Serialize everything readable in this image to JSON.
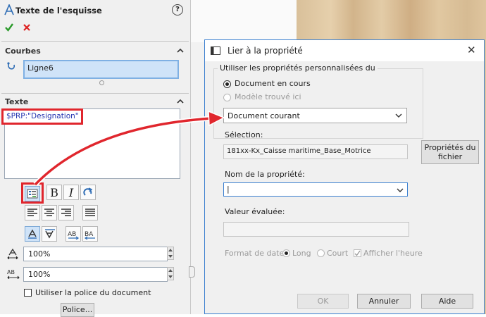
{
  "panel": {
    "title": "Texte de l'esquisse",
    "help_glyph": "?",
    "curves_section": "Courbes",
    "curve_value": "Ligne6",
    "text_section": "Texte",
    "text_value": "$PRP:\"Designation\"",
    "format_bold": "B",
    "format_italic": "I",
    "width_value": "100%",
    "spacing_value": "100%",
    "use_document_font": "Utiliser la police du document",
    "font_button": "Police...",
    "accent_color": "#2f6db5",
    "highlight_color": "#e0262d"
  },
  "dialog": {
    "title": "Lier à la propriété",
    "group_label": "Utiliser les propriétés personnalisées du",
    "radio_document": "Document en cours",
    "radio_model": "Modèle trouvé ici",
    "source_combo": "Document courant",
    "selection_label": "Sélection:",
    "selection_value": "181xx-Kx_Caisse maritime_Base_Motrice",
    "file_props_button_line1": "Propriétés du",
    "file_props_button_line2": "fichier",
    "property_name_label": "Nom de la propriété:",
    "property_name_value": "|",
    "evaluated_label": "Valeur évaluée:",
    "evaluated_value": "",
    "date_format_label": "Format de date:",
    "date_long": "Long",
    "date_short": "Court",
    "show_time": "Afficher l'heure",
    "ok_button": "OK",
    "cancel_button": "Annuler",
    "help_button": "Aide",
    "close_glyph": "✕"
  }
}
